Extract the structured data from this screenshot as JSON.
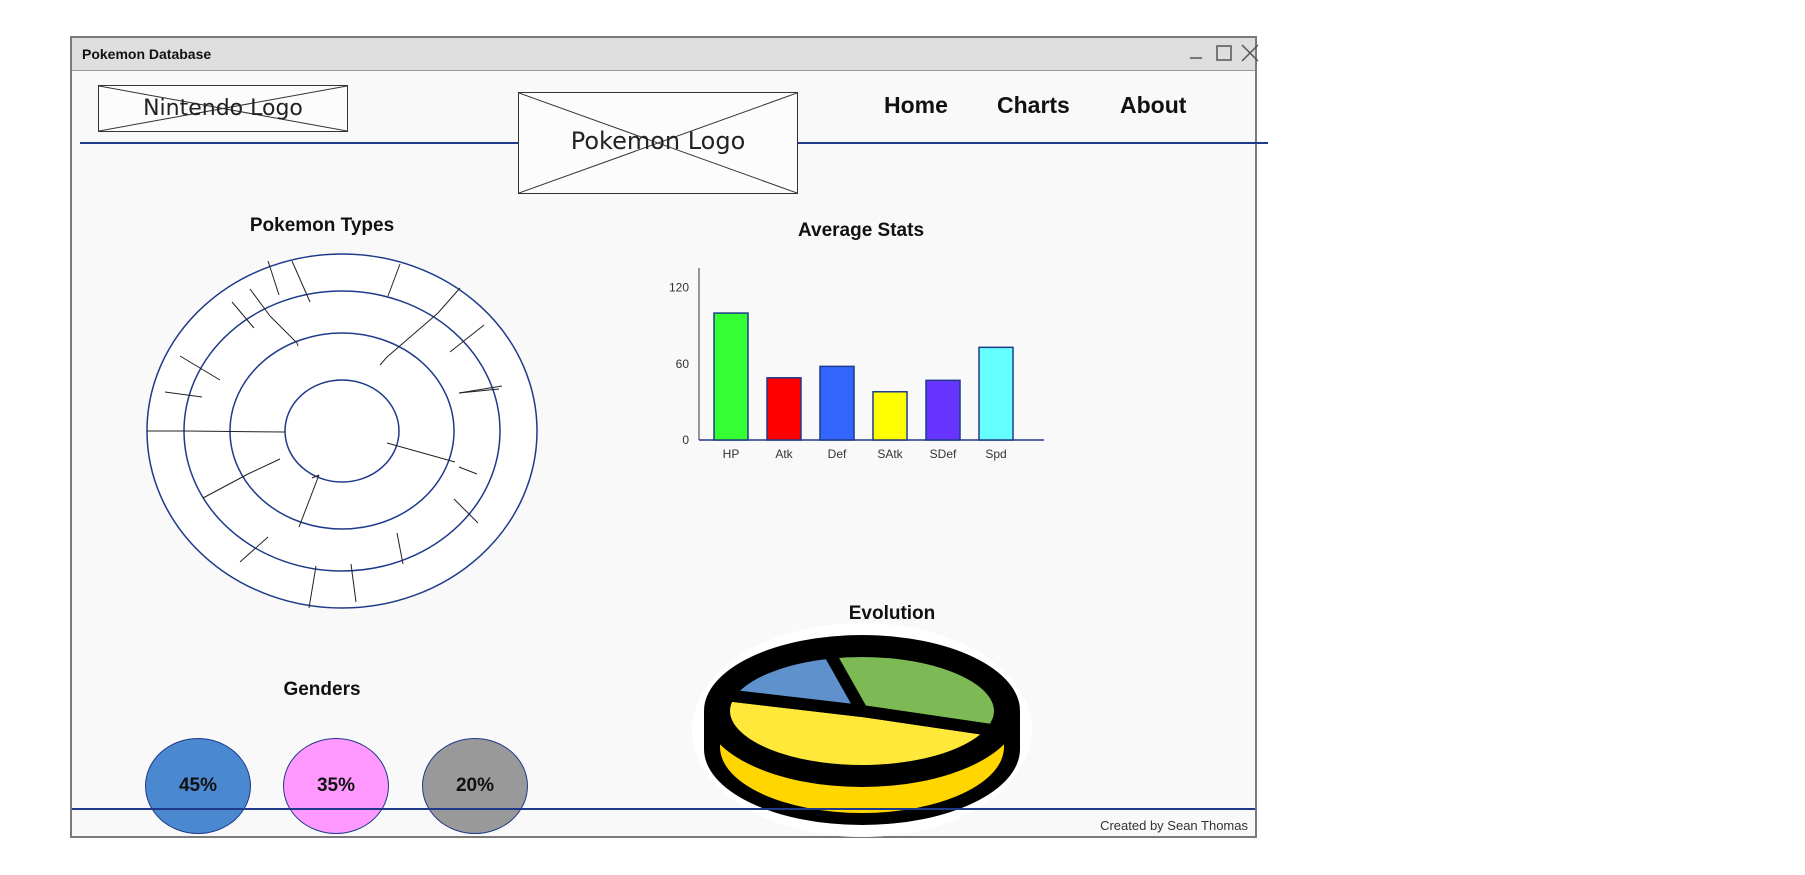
{
  "window": {
    "title": "Pokemon Database",
    "controls": [
      "minimize-icon",
      "maximize-icon",
      "close-icon"
    ]
  },
  "header": {
    "nintendo_logo": "Nintendo Logo",
    "pokemon_logo": "Pokemon Logo",
    "nav": [
      {
        "label": "Home"
      },
      {
        "label": "Charts"
      },
      {
        "label": "About"
      }
    ]
  },
  "sections": {
    "types_title": "Pokemon Types",
    "stats_title": "Average Stats",
    "evolution_title": "Evolution",
    "genders_title": "Genders"
  },
  "genders": [
    {
      "label": "45%",
      "color": "#4a88d0"
    },
    {
      "label": "35%",
      "color": "#ff99ff"
    },
    {
      "label": "20%",
      "color": "#999999"
    }
  ],
  "footer": {
    "credit": "Created by Sean Thomas"
  },
  "chart_data": [
    {
      "type": "bar",
      "title": "Average Stats",
      "categories": [
        "HP",
        "Atk",
        "Def",
        "SAtk",
        "SDef",
        "Spd"
      ],
      "values": [
        100,
        49,
        58,
        38,
        47,
        73
      ],
      "colors": [
        "#33ff33",
        "#ff0000",
        "#3366ff",
        "#ffff00",
        "#6633ff",
        "#66ffff"
      ],
      "ylim": [
        0,
        130
      ],
      "yticks": [
        0,
        60,
        120
      ],
      "grid": false
    },
    {
      "type": "pie",
      "title": "Evolution",
      "slices": [
        {
          "value": 49,
          "color": "#ffe83a"
        },
        {
          "value": 34,
          "color": "#7db955"
        },
        {
          "value": 17,
          "color": "#5f91cc"
        }
      ]
    }
  ]
}
